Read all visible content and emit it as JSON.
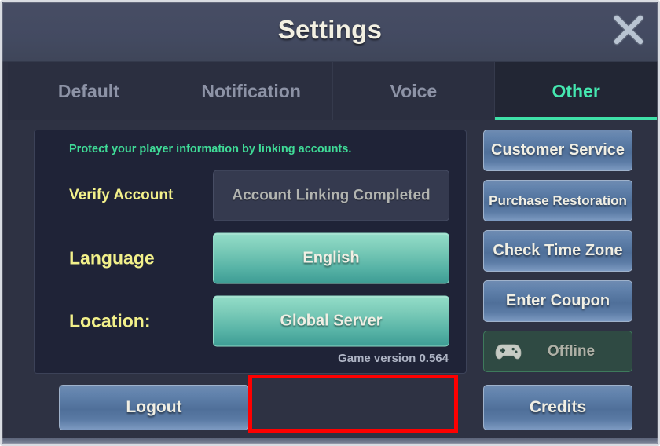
{
  "window": {
    "title": "Settings",
    "close_icon": "close-x-icon"
  },
  "tabs": [
    {
      "label": "Default",
      "active": false
    },
    {
      "label": "Notification",
      "active": false
    },
    {
      "label": "Voice",
      "active": false
    },
    {
      "label": "Other",
      "active": true
    }
  ],
  "account_panel": {
    "notice": "Protect your player information by linking accounts.",
    "rows": [
      {
        "label": "Verify Account",
        "value": "Account Linking Completed",
        "state": "disabled"
      },
      {
        "label": "Language",
        "value": "English",
        "state": "enabled"
      },
      {
        "label": "Location:",
        "value": "Global Server",
        "state": "enabled"
      }
    ],
    "game_version": "Game version 0.564"
  },
  "side_buttons": [
    {
      "label": "Customer Service"
    },
    {
      "label": "Purchase Restoration"
    },
    {
      "label": "Check Time Zone"
    },
    {
      "label": "Enter Coupon"
    }
  ],
  "offline_status": {
    "label": "Offline",
    "icon": "gamepad-icon"
  },
  "bottom_buttons": {
    "logout": "Logout",
    "credits": "Credits"
  },
  "colors": {
    "accent_teal": "#3fe0a8",
    "notice_green": "#3fdb97",
    "label_yellow": "#f2f08a",
    "button_blue": "#5b7ba5",
    "highlight_red": "#fe0000",
    "panel_dark": "#1f2337",
    "window_bg": "#2e3243"
  }
}
